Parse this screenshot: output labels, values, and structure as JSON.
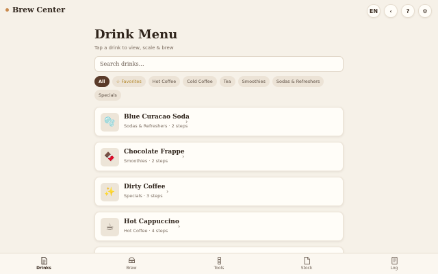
{
  "app": {
    "name": "Brew Center"
  },
  "topbar": {
    "language_label": "EN",
    "back_label": "‹",
    "help_label": "?",
    "settings_label": "⚙"
  },
  "header": {
    "title": "Drink Menu",
    "subtitle": "Tap a drink to view, scale & brew"
  },
  "search": {
    "placeholder": "Search drinks…",
    "value": ""
  },
  "filters": {
    "all": "All",
    "favorites": "☆ Favorites",
    "hot_coffee": "Hot Coffee",
    "cold_coffee": "Cold Coffee",
    "tea": "Tea",
    "smoothies": "Smoothies",
    "sodas": "Sodas & Refreshers",
    "specials": "Specials",
    "selected": "All"
  },
  "drinks": [
    {
      "name": "Blue Curacao Soda",
      "meta": "Sodas & Refreshers · 2 steps",
      "icon": "🫧",
      "icon_name": "bubbles-icon"
    },
    {
      "name": "Chocolate Frappe",
      "meta": "Smoothies · 2 steps",
      "icon": "🍫",
      "icon_name": "chocolate-icon"
    },
    {
      "name": "Dirty Coffee",
      "meta": "Specials · 3 steps",
      "icon": "✨",
      "icon_name": "sparkles-icon"
    },
    {
      "name": "Hot Cappuccino",
      "meta": "Hot Coffee · 4 steps",
      "icon": "☕",
      "icon_name": "coffee-cup-icon"
    }
  ],
  "nav": {
    "drinks": "Drinks",
    "brew": "Brew",
    "tools": "Tools",
    "stock": "Stock",
    "log": "Log",
    "active": "Drinks"
  },
  "colors": {
    "background": "#f6f1e8",
    "accent_brown": "#5a3b2a",
    "brand_dot": "#c98a4e",
    "card": "#fffdf8"
  }
}
